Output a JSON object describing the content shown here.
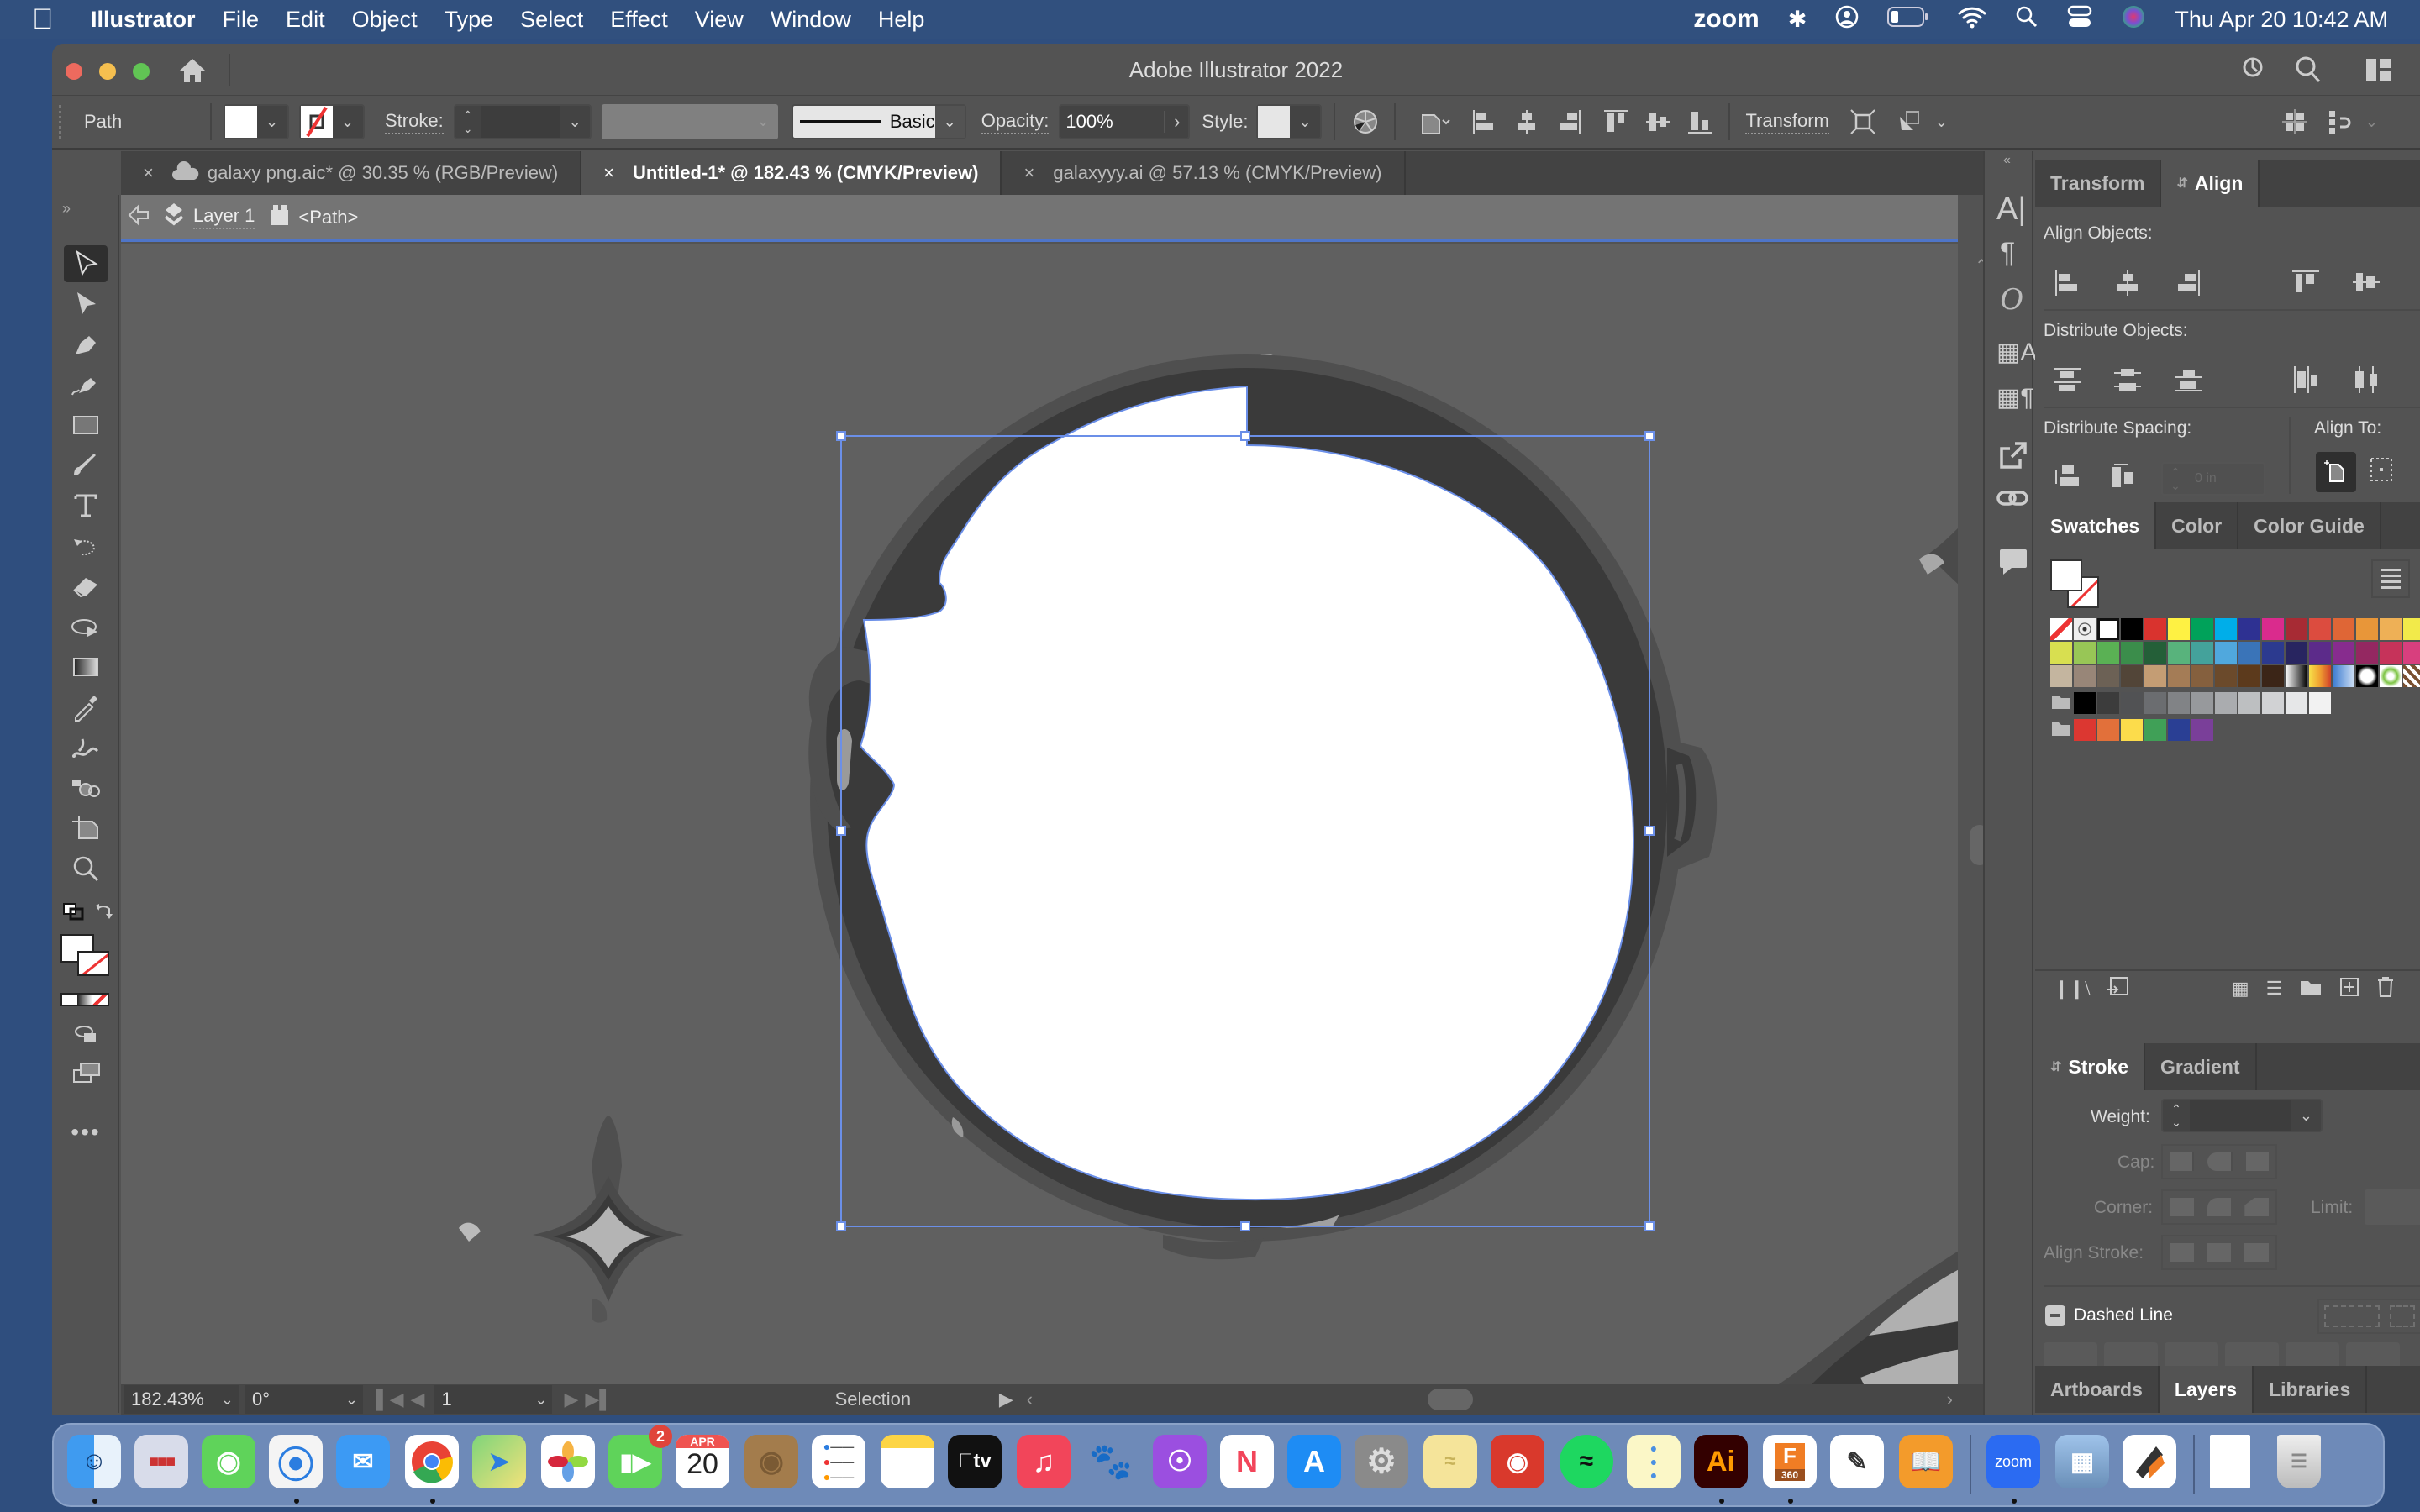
{
  "menubar": {
    "app": "Illustrator",
    "items": [
      "File",
      "Edit",
      "Object",
      "Type",
      "Select",
      "Effect",
      "View",
      "Window",
      "Help"
    ],
    "status": {
      "zoom_label": "zoom",
      "datetime": "Thu Apr 20  10:42 AM"
    }
  },
  "window": {
    "title": "Adobe Illustrator 2022"
  },
  "control_bar": {
    "selection_type": "Path",
    "stroke_label": "Stroke:",
    "stroke_weight": "",
    "brush_label": "Basic",
    "opacity_label": "Opacity:",
    "opacity_value": "100%",
    "style_label": "Style:",
    "transform_label": "Transform"
  },
  "doc_tabs": [
    {
      "label": "galaxy png.aic* @ 30.35 % (RGB/Preview)",
      "active": false,
      "cloud": true
    },
    {
      "label": "Untitled-1* @ 182.43 % (CMYK/Preview)",
      "active": true
    },
    {
      "label": "galaxyyy.ai @ 57.13 % (CMYK/Preview)",
      "active": false
    }
  ],
  "breadcrumb": {
    "layer": "Layer 1",
    "object": "<Path>"
  },
  "status_bar": {
    "zoom": "182.43%",
    "rotation": "0°",
    "artboard": "1",
    "tool": "Selection"
  },
  "align_panel": {
    "tabs": [
      "Transform",
      "Align"
    ],
    "align_objects": "Align Objects:",
    "distribute_objects": "Distribute Objects:",
    "distribute_spacing": "Distribute Spacing:",
    "spacing_value": "0 in",
    "align_to": "Align To:"
  },
  "swatches_panel": {
    "tabs": [
      "Swatches",
      "Color",
      "Color Guide"
    ],
    "rows": [
      [
        "none",
        "registration",
        "white",
        "#000000",
        "#d9332e",
        "#fef143",
        "#00a25a",
        "#00aee9",
        "#2e3192",
        "#da2b8d",
        "#a72b34",
        "#dc4c3f",
        "#df6636",
        "#e89639",
        "#eeb056",
        "#f2ea4a"
      ],
      [
        "#d8df50",
        "#98c656",
        "#5ab154",
        "#3b8d4b",
        "#245f38",
        "#58b37c",
        "#44a29b",
        "#50a8dd",
        "#3a74b8",
        "#2c3a8f",
        "#282560",
        "#5c2b8a",
        "#872c8e",
        "#942861",
        "#c6335a",
        "#d83f7e"
      ],
      [
        "#c4b59f",
        "#988678",
        "#6c6155",
        "#524538",
        "#c49d74",
        "#a47c56",
        "#85603e",
        "#6b4a2b",
        "#5c3a1c",
        "#3b2517",
        "grad-bw",
        "grad-fire",
        "pattern-blue",
        "pattern-dot",
        "pattern-leaf",
        "pattern-brown"
      ],
      [
        "folder",
        "#000000",
        "#3c3c3c",
        "#515254",
        "#6b6d70",
        "#818386",
        "#97999c",
        "#aaacaf",
        "#bdbfc1",
        "#d1d2d4",
        "#e6e7e8",
        "#f2f2f2"
      ],
      [
        "folder",
        "#dc3731",
        "#e2703a",
        "#fcdc4b",
        "#40a057",
        "#2a3f94",
        "#7a3f99"
      ]
    ]
  },
  "stroke_panel": {
    "tabs": [
      "Stroke",
      "Gradient"
    ],
    "weight_label": "Weight:",
    "cap_label": "Cap:",
    "corner_label": "Corner:",
    "limit_label": "Limit:",
    "align_stroke_label": "Align Stroke:",
    "dashed_line_label": "Dashed Line",
    "dash_fields": [
      "dash",
      "gap",
      "dash",
      "gap",
      "dash",
      "gap"
    ]
  },
  "bottom_tabs": [
    "Artboards",
    "Layers",
    "Libraries"
  ],
  "dock": {
    "facetime_badge": "2",
    "calendar_month": "APR",
    "calendar_day": "20",
    "illustrator_label": "Ai",
    "fusion_label": "F",
    "fusion_sub": "360",
    "zoom_label": "zoom"
  },
  "colors": {
    "selection": "#4f75e8",
    "menubar": "#31507e",
    "ui": "#535353",
    "canvas": "#606060"
  }
}
